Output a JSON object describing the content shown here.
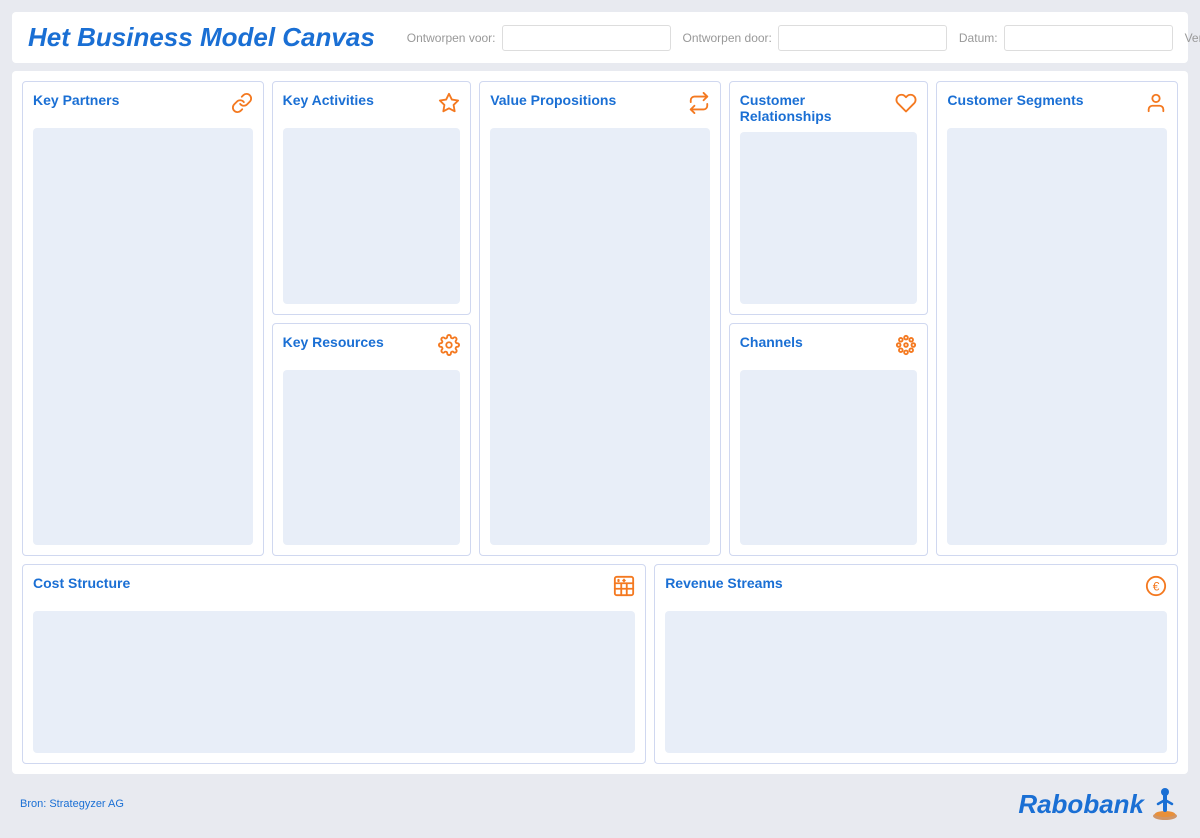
{
  "header": {
    "title": "Het Business Model Canvas",
    "fields": [
      {
        "label": "Ontworpen voor:",
        "placeholder": "",
        "value": ""
      },
      {
        "label": "Ontworpen door:",
        "placeholder": "",
        "value": ""
      },
      {
        "label": "Datum:",
        "placeholder": "",
        "value": ""
      },
      {
        "label": "Versie:",
        "placeholder": "",
        "value": ""
      }
    ]
  },
  "cells": {
    "key_partners": {
      "title": "Key Partners"
    },
    "key_activities": {
      "title": "Key Activities"
    },
    "key_resources": {
      "title": "Key Resources"
    },
    "value_propositions": {
      "title": "Value Propositions"
    },
    "customer_relationships": {
      "title": "Customer Relationships"
    },
    "channels": {
      "title": "Channels"
    },
    "customer_segments": {
      "title": "Customer Segments"
    },
    "cost_structure": {
      "title": "Cost Structure"
    },
    "revenue_streams": {
      "title": "Revenue Streams"
    }
  },
  "footer": {
    "source": "Bron: Strategyzer AG",
    "logo_text": "Rabobank"
  }
}
